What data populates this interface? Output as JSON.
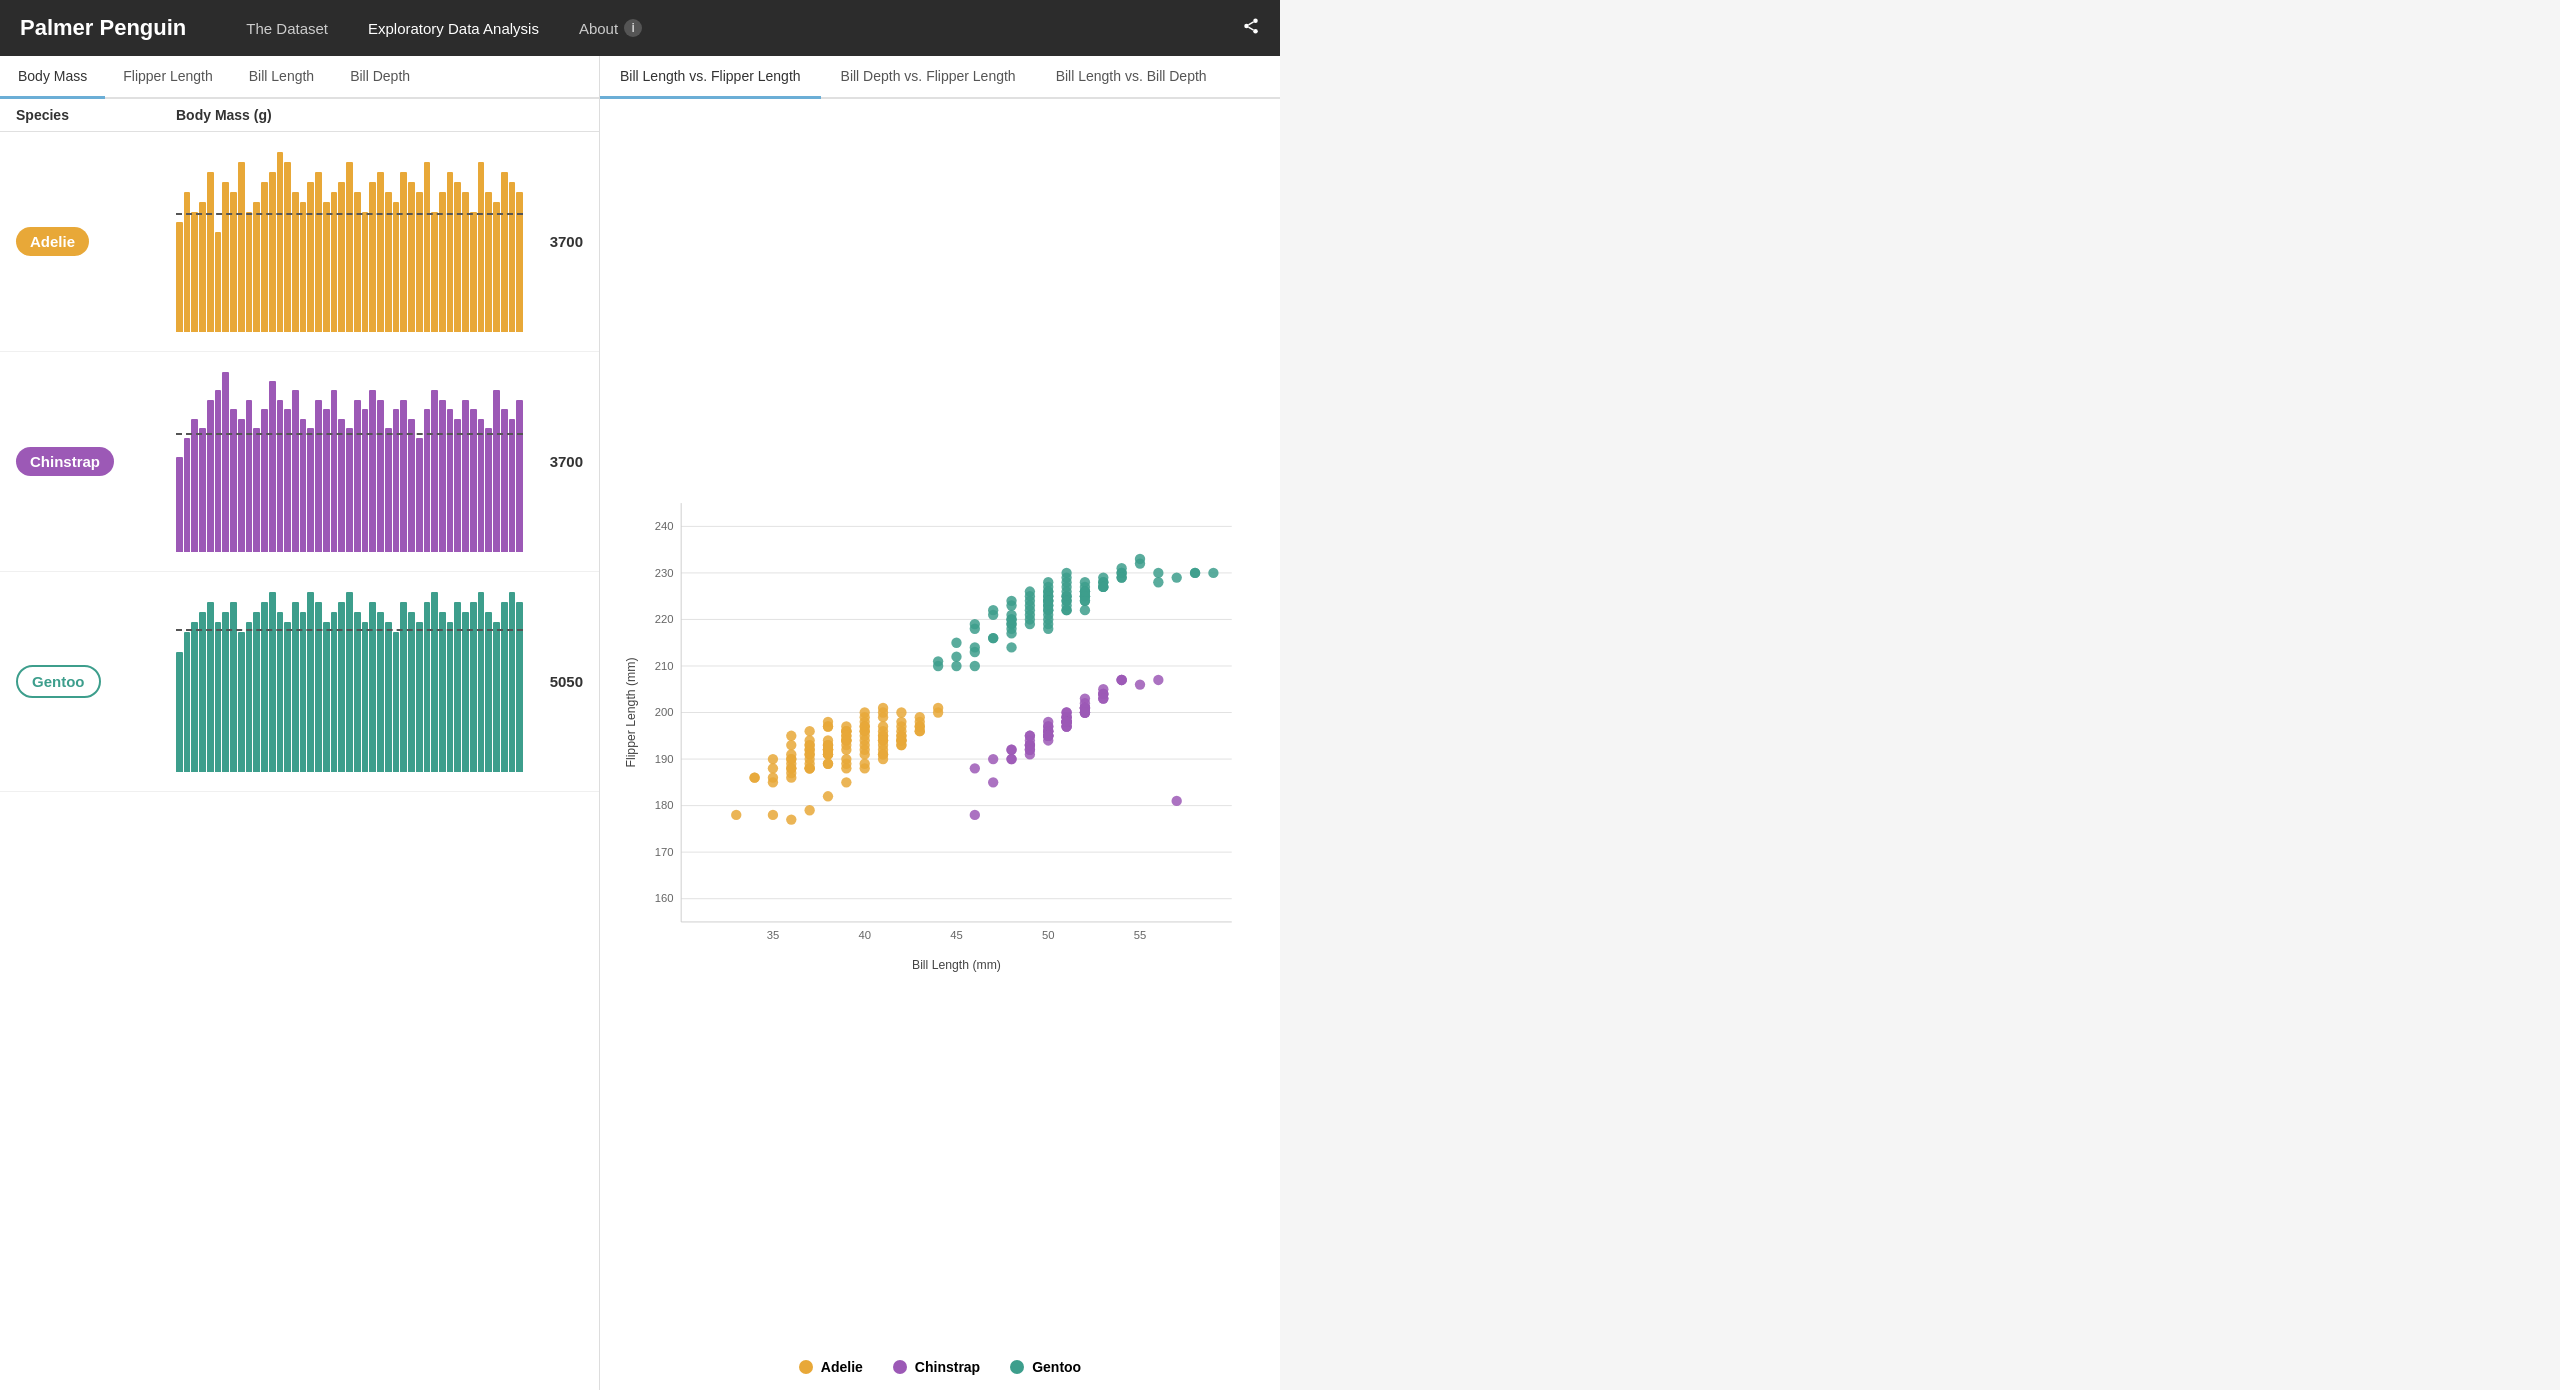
{
  "navbar": {
    "brand": "Palmer Penguin",
    "nav_items": [
      {
        "id": "dataset",
        "label": "The Dataset",
        "active": false
      },
      {
        "id": "eda",
        "label": "Exploratory Data Analysis",
        "active": true
      },
      {
        "id": "about",
        "label": "About",
        "active": false,
        "has_icon": true
      }
    ],
    "share_icon": "share"
  },
  "left_panel": {
    "tabs": [
      {
        "id": "body-mass",
        "label": "Body Mass",
        "active": true
      },
      {
        "id": "flipper-length",
        "label": "Flipper Length",
        "active": false
      },
      {
        "id": "bill-length",
        "label": "Bill Length",
        "active": false
      },
      {
        "id": "bill-depth",
        "label": "Bill Depth",
        "active": false
      }
    ],
    "table_header": {
      "col1": "Species",
      "col2": "Body Mass (g)"
    },
    "species": [
      {
        "id": "adelie",
        "label": "Adelie",
        "badge_class": "badge-adelie",
        "bar_class": "bar-adelie",
        "mean_value": "3700",
        "mean_pct": 65,
        "bars": [
          55,
          70,
          60,
          65,
          80,
          50,
          75,
          70,
          85,
          60,
          65,
          75,
          80,
          90,
          85,
          70,
          65,
          75,
          80,
          65,
          70,
          75,
          85,
          70,
          60,
          75,
          80,
          70,
          65,
          80,
          75,
          70,
          85,
          60,
          70,
          80,
          75,
          70,
          60,
          85,
          70,
          65,
          80,
          75,
          70
        ]
      },
      {
        "id": "chinstrap",
        "label": "Chinstrap",
        "badge_class": "badge-chinstrap",
        "bar_class": "bar-chinstrap",
        "mean_value": "3700",
        "mean_pct": 65,
        "bars": [
          50,
          60,
          70,
          65,
          80,
          85,
          95,
          75,
          70,
          80,
          65,
          75,
          90,
          80,
          75,
          85,
          70,
          65,
          80,
          75,
          85,
          70,
          65,
          80,
          75,
          85,
          80,
          65,
          75,
          80,
          70,
          60,
          75,
          85,
          80,
          75,
          70,
          80,
          75,
          70,
          65,
          85,
          75,
          70,
          80
        ]
      },
      {
        "id": "gentoo",
        "label": "Gentoo",
        "badge_class": "badge-gentoo",
        "bar_class": "bar-gentoo",
        "mean_value": "5050",
        "mean_pct": 78,
        "bars": [
          60,
          70,
          75,
          80,
          85,
          75,
          80,
          85,
          70,
          75,
          80,
          85,
          90,
          80,
          75,
          85,
          80,
          90,
          85,
          75,
          80,
          85,
          90,
          80,
          75,
          85,
          80,
          75,
          70,
          85,
          80,
          75,
          85,
          90,
          80,
          75,
          85,
          80,
          85,
          90,
          80,
          75,
          85,
          90,
          85
        ]
      }
    ]
  },
  "right_panel": {
    "tabs": [
      {
        "id": "bill-vs-flipper",
        "label": "Bill Length vs. Flipper Length",
        "active": true
      },
      {
        "id": "depth-vs-flipper",
        "label": "Bill Depth vs. Flipper Length",
        "active": false
      },
      {
        "id": "bill-vs-depth",
        "label": "Bill Length vs. Bill Depth",
        "active": false
      }
    ],
    "scatter": {
      "x_label": "Bill Length (mm)",
      "y_label": "Flipper Length (mm)",
      "x_min": 30,
      "x_max": 60,
      "y_min": 155,
      "y_max": 240,
      "y_ticks": [
        160,
        170,
        180,
        190,
        200,
        210,
        220,
        230,
        240
      ],
      "x_ticks": [
        35,
        40,
        45,
        50,
        55
      ]
    },
    "legend": [
      {
        "id": "adelie",
        "label": "Adelie",
        "color": "#e8a838"
      },
      {
        "id": "chinstrap",
        "label": "Chinstrap",
        "color": "#9c59b6"
      },
      {
        "id": "gentoo",
        "label": "Gentoo",
        "color": "#3d9e8c"
      }
    ]
  }
}
